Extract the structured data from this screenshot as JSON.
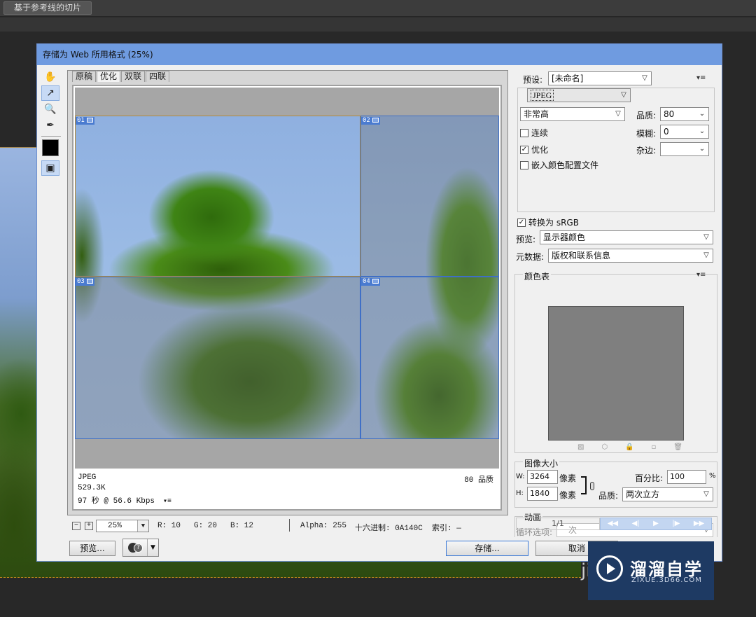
{
  "app": {
    "top_button": "基于参考线的切片"
  },
  "dialog": {
    "title": "存储为 Web 所用格式 (25%)"
  },
  "tabs": [
    {
      "label": "原稿"
    },
    {
      "label": "优化"
    },
    {
      "label": "双联"
    },
    {
      "label": "四联"
    }
  ],
  "slices": [
    "01",
    "02",
    "03",
    "04"
  ],
  "preview_info": {
    "format": "JPEG",
    "size": "529.3K",
    "time": "97 秒 @ 56.6 Kbps",
    "quality": "80 品质"
  },
  "status": {
    "zoom": "25%",
    "r": "R: 10",
    "g": "G: 20",
    "b": "B: 12",
    "alpha": "Alpha: 255",
    "hex": "十六进制: 0A140C",
    "index": "索引: —"
  },
  "buttons": {
    "preview": "预览...",
    "save": "存储...",
    "cancel": "取消"
  },
  "settings": {
    "preset_label": "预设:",
    "preset_value": "[未命名]",
    "format_value": "JPEG",
    "quality_level": "非常高",
    "quality_label": "品质:",
    "quality_value": "80",
    "blur_label": "模糊:",
    "blur_value": "0",
    "matte_label": "杂边:",
    "progressive_label": "连续",
    "optimized_label": "优化",
    "embed_profile_label": "嵌入颜色配置文件",
    "convert_srgb_label": "转换为 sRGB",
    "preview_label": "预览:",
    "preview_value": "显示器颜色",
    "metadata_label": "元数据:",
    "metadata_value": "版权和联系信息"
  },
  "color_table": {
    "title": "颜色表"
  },
  "image_size": {
    "title": "图像大小",
    "w_label": "W:",
    "w_value": "3264",
    "h_label": "H:",
    "h_value": "1840",
    "unit": "像素",
    "percent_label": "百分比:",
    "percent_value": "100",
    "percent_unit": "%",
    "quality_label": "品质:",
    "quality_value": "两次立方"
  },
  "animation": {
    "title": "动画",
    "loop_label": "循环选项:",
    "loop_value": "一次",
    "frame": "1/1"
  },
  "watermark": {
    "title": "溜溜自学",
    "url": "ZIXUE.3D66.COM"
  },
  "bg_text": "ji"
}
